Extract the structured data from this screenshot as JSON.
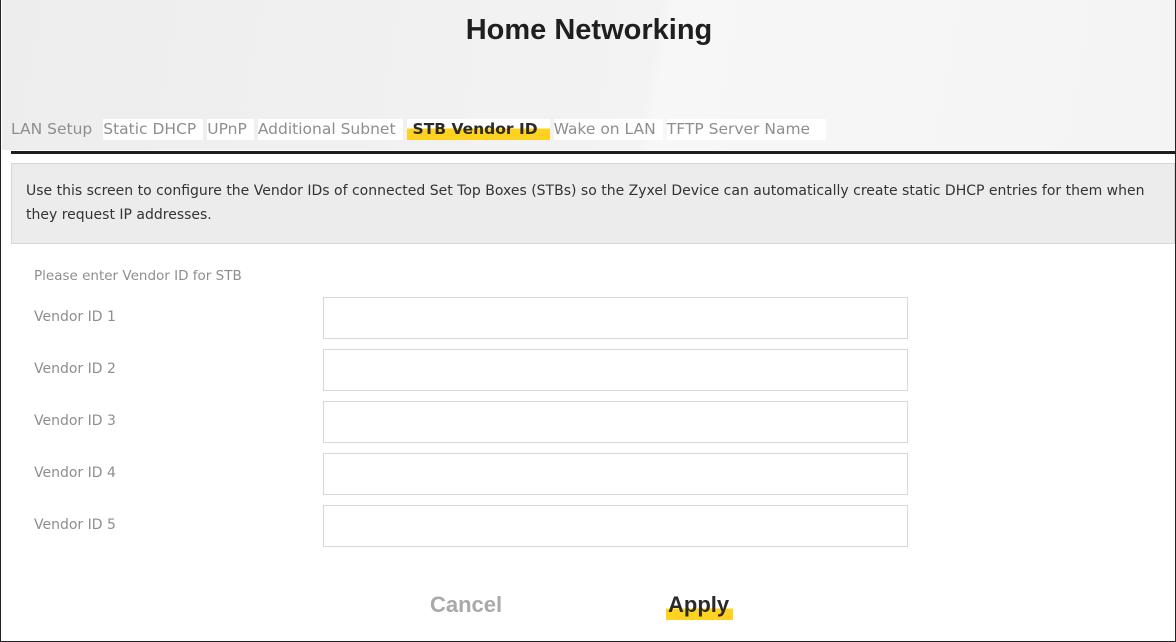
{
  "page": {
    "title": "Home Networking"
  },
  "tabs": [
    {
      "label": "LAN Setup",
      "active": false
    },
    {
      "label": "Static DHCP",
      "active": false
    },
    {
      "label": "UPnP",
      "active": false
    },
    {
      "label": "Additional Subnet",
      "active": false
    },
    {
      "label": "STB Vendor ID",
      "active": true
    },
    {
      "label": "Wake on LAN",
      "active": false
    },
    {
      "label": "TFTP Server Name",
      "active": false
    }
  ],
  "info": {
    "text": "Use this screen to configure the Vendor IDs of connected Set Top Boxes (STBs) so the Zyxel Device can automatically create static DHCP entries for them when they request IP addresses."
  },
  "form": {
    "heading": "Please enter Vendor ID for STB",
    "fields": [
      {
        "label": "Vendor ID 1",
        "value": ""
      },
      {
        "label": "Vendor ID 2",
        "value": ""
      },
      {
        "label": "Vendor ID 3",
        "value": ""
      },
      {
        "label": "Vendor ID 4",
        "value": ""
      },
      {
        "label": "Vendor ID 5",
        "value": ""
      }
    ]
  },
  "buttons": {
    "cancel_label": "Cancel",
    "apply_label": "Apply"
  },
  "colors": {
    "accent": "#ffd21f",
    "text_muted": "#8e8e8e",
    "info_bg": "#ececec"
  }
}
